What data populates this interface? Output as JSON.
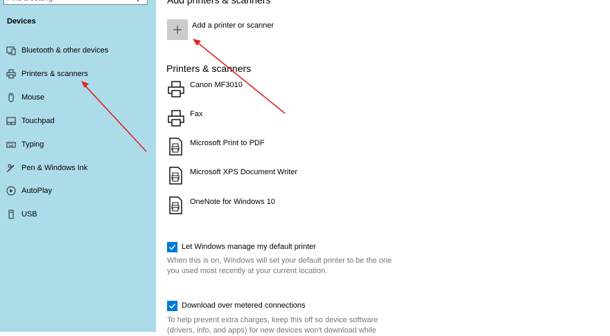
{
  "sidebar": {
    "search_placeholder": "Find a setting",
    "section_title": "Devices",
    "items": [
      {
        "label": "Bluetooth & other devices",
        "icon": "bluetooth-devices-icon"
      },
      {
        "label": "Printers & scanners",
        "icon": "printer-icon"
      },
      {
        "label": "Mouse",
        "icon": "mouse-icon"
      },
      {
        "label": "Touchpad",
        "icon": "touchpad-icon"
      },
      {
        "label": "Typing",
        "icon": "keyboard-icon"
      },
      {
        "label": "Pen & Windows Ink",
        "icon": "pen-icon"
      },
      {
        "label": "AutoPlay",
        "icon": "autoplay-icon"
      },
      {
        "label": "USB",
        "icon": "usb-icon"
      }
    ]
  },
  "main": {
    "top_heading": "Add printers & scanners",
    "add_label": "Add a printer or scanner",
    "printers_heading": "Printers & scanners",
    "printers": [
      {
        "name": "Canon MF3010",
        "icon": "printer-icon"
      },
      {
        "name": "Fax",
        "icon": "printer-icon"
      },
      {
        "name": "Microsoft Print to PDF",
        "icon": "document-printer-icon"
      },
      {
        "name": "Microsoft XPS Document Writer",
        "icon": "document-printer-icon"
      },
      {
        "name": "OneNote for Windows 10",
        "icon": "document-printer-icon"
      }
    ],
    "default_printer": {
      "label": "Let Windows manage my default printer",
      "checked": true,
      "desc1": "When this is on, Windows will set your default printer to be the one",
      "desc2": "you used most recently at your current location."
    },
    "metered": {
      "label": "Download over metered connections",
      "checked": true,
      "desc1": "To help prevent extra charges, keep this off so device software",
      "desc2": "(drivers, info, and apps) for new devices won't download while"
    }
  },
  "colors": {
    "sidebar_bg": "#acdcea",
    "accent": "#0078d7",
    "arrow": "#e02020"
  }
}
